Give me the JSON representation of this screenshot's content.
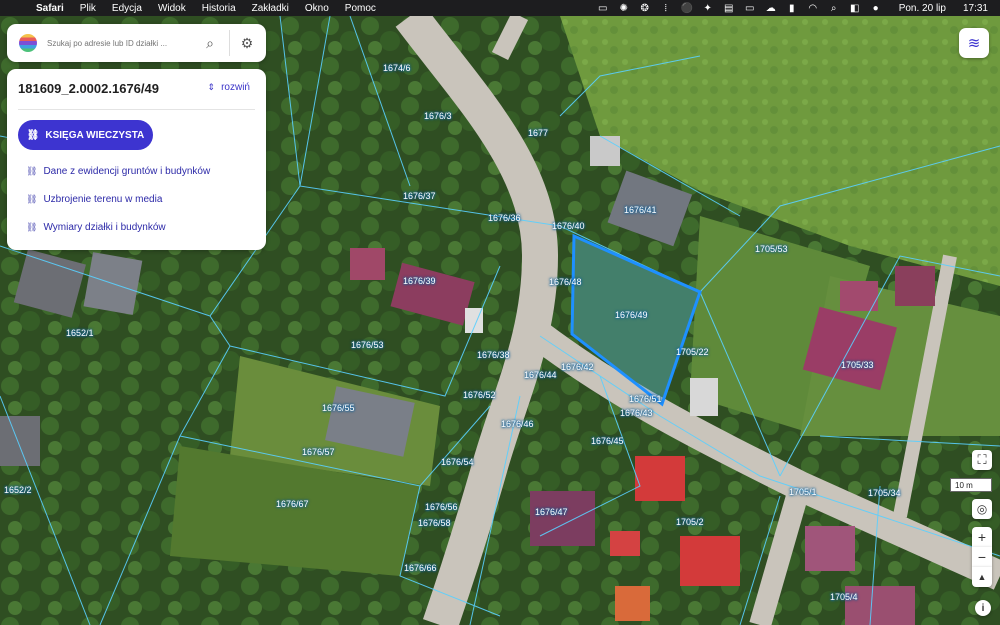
{
  "menubar": {
    "apple": "",
    "app": "Safari",
    "items": [
      "Plik",
      "Edycja",
      "Widok",
      "Historia",
      "Zakładki",
      "Okno",
      "Pomoc"
    ],
    "date": "Pon. 20 lip",
    "time": "17:31"
  },
  "search": {
    "placeholder": "Szukaj po adresie lub ID działki ..."
  },
  "panel": {
    "parcel_id": "181609_2.0002.1676/49",
    "expand_label": "rozwiń",
    "primary_button": "KSIĘGA WIECZYSTA",
    "links": [
      "Dane z ewidencji gruntów i budynków",
      "Uzbrojenie terenu w media",
      "Wymiary działki i budynków"
    ]
  },
  "map": {
    "scale_label": "10 m",
    "parcel_labels": [
      "1674/6",
      "1676/3",
      "1677",
      "1676/37",
      "1676/36",
      "1676/40",
      "1676/41",
      "1705/53",
      "1676/39",
      "1676/48",
      "1676/49",
      "1652/1",
      "1676/53",
      "1676/38",
      "1705/22",
      "1705/33",
      "1676/44",
      "1676/42",
      "1676/52",
      "1676/51",
      "1676/43",
      "1676/55",
      "1676/46",
      "1676/45",
      "1676/57",
      "1676/54",
      "1652/2",
      "1705/1",
      "1705/34",
      "1676/67",
      "1676/56",
      "1676/47",
      "1676/58",
      "1705/2",
      "1676/66",
      "1705/4"
    ]
  },
  "colors": {
    "accent": "#3d34d0",
    "parcel_line": "#5ad0ff",
    "selected_parcel": "#1e90ff"
  }
}
